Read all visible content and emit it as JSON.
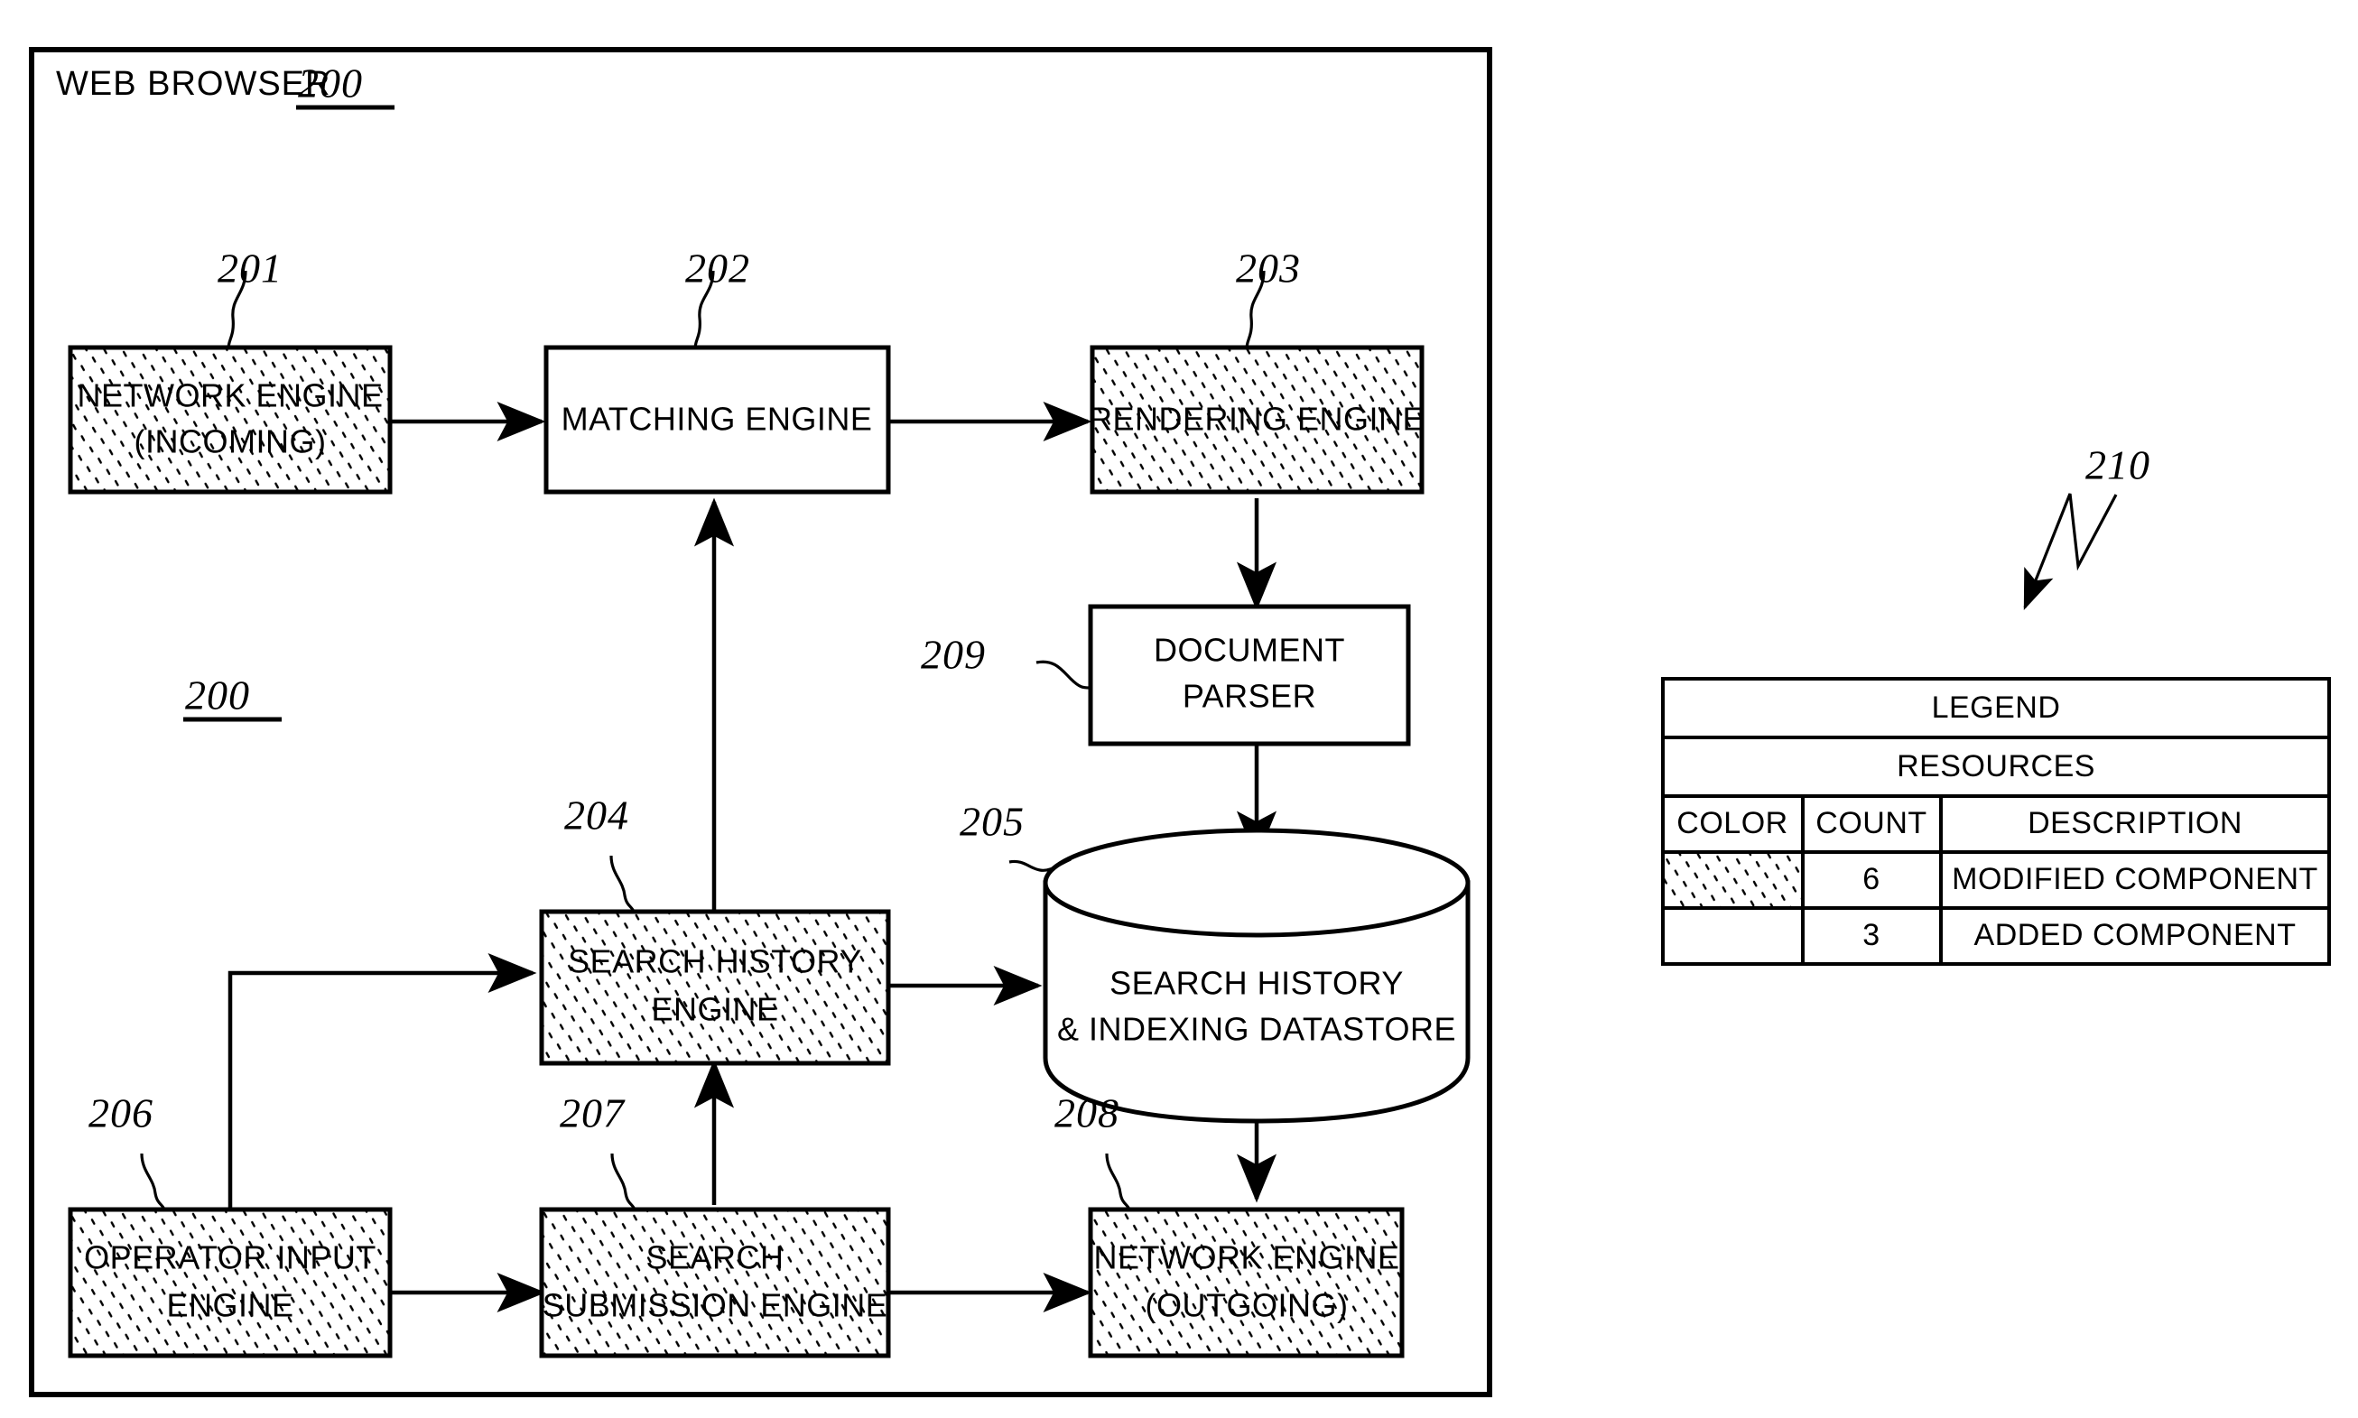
{
  "figure": {
    "frame_title": "WEB BROWSER",
    "frame_ref": "200",
    "inner_ref": "200",
    "legend_ref": "210"
  },
  "blocks": [
    {
      "id": "network-engine-incoming",
      "ref": "201",
      "lines": [
        "NETWORK ENGINE",
        "(INCOMING)"
      ],
      "fill": "stipple"
    },
    {
      "id": "matching-engine",
      "ref": "202",
      "lines": [
        "MATCHING ENGINE"
      ],
      "fill": "white"
    },
    {
      "id": "rendering-engine",
      "ref": "203",
      "lines": [
        "RENDERING ENGINE"
      ],
      "fill": "stipple"
    },
    {
      "id": "document-parser",
      "ref": "209",
      "lines": [
        "DOCUMENT",
        "PARSER"
      ],
      "fill": "white"
    },
    {
      "id": "search-history-datastore",
      "ref": "205",
      "lines": [
        "SEARCH HISTORY",
        "& INDEXING DATASTORE"
      ],
      "fill": "white"
    },
    {
      "id": "search-history-engine",
      "ref": "204",
      "lines": [
        "SEARCH HISTORY",
        "ENGINE"
      ],
      "fill": "stipple"
    },
    {
      "id": "operator-input-engine",
      "ref": "206",
      "lines": [
        "OPERATOR INPUT",
        "ENGINE"
      ],
      "fill": "stipple"
    },
    {
      "id": "search-submission-engine",
      "ref": "207",
      "lines": [
        "SEARCH",
        "SUBMISSION ENGINE"
      ],
      "fill": "stipple"
    },
    {
      "id": "network-engine-outgoing",
      "ref": "208",
      "lines": [
        "NETWORK ENGINE",
        "(OUTGOING)"
      ],
      "fill": "stipple"
    }
  ],
  "legend": {
    "title": "LEGEND",
    "subtitle": "RESOURCES",
    "columns": [
      "COLOR",
      "COUNT",
      "DESCRIPTION"
    ],
    "rows": [
      {
        "swatch": "stipple",
        "count": "6",
        "description": "MODIFIED COMPONENT"
      },
      {
        "swatch": "white",
        "count": "3",
        "description": "ADDED COMPONENT"
      }
    ]
  },
  "colors": {
    "line": "#000000",
    "background": "#ffffff",
    "stipple_dot": "#000000"
  }
}
